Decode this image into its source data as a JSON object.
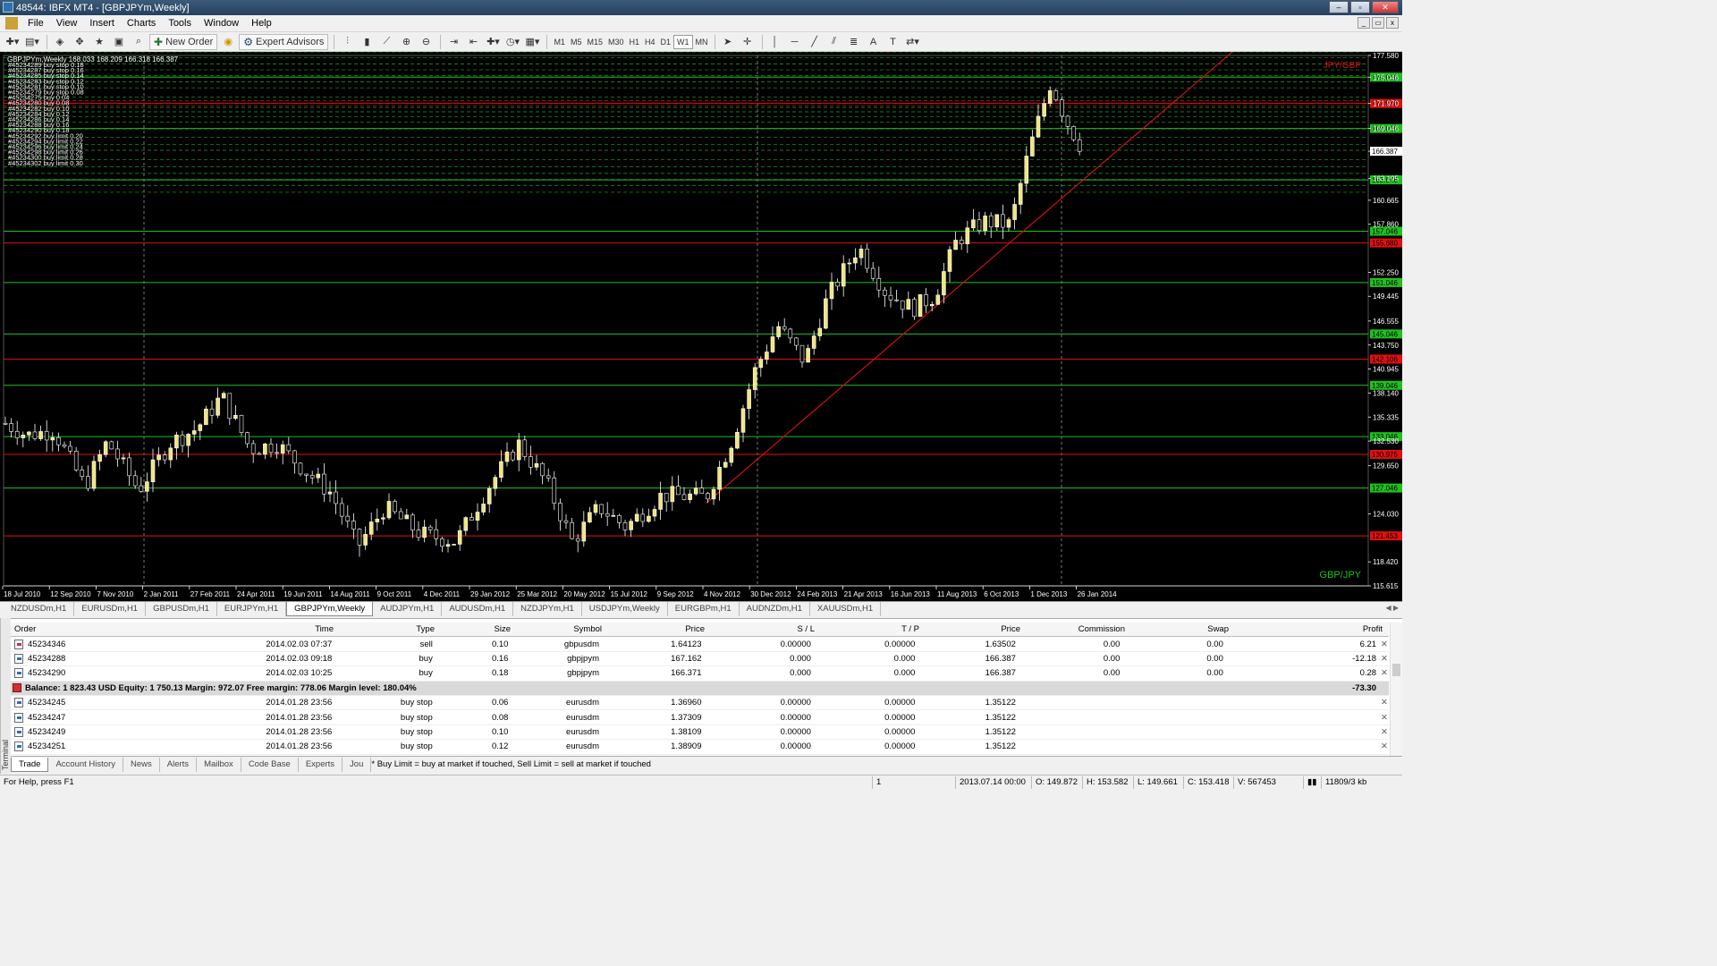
{
  "window": {
    "title": "48544: IBFX MT4 - [GBPJPYm,Weekly]"
  },
  "menu": [
    "File",
    "View",
    "Insert",
    "Charts",
    "Tools",
    "Window",
    "Help"
  ],
  "toolbar": {
    "new_order": "New Order",
    "expert_advisors": "Expert Advisors",
    "timeframes": [
      "M1",
      "M5",
      "M15",
      "M30",
      "H1",
      "H4",
      "D1",
      "W1",
      "MN"
    ],
    "active_timeframe": "W1",
    "text_tool": "A"
  },
  "chart": {
    "header": "GBPJPYm,Weekly  168.033 168.209 166.318 166.387",
    "overlay_label_top": "JPY/GBP",
    "overlay_label_bottom": "GBP/JPY",
    "price_axis": [
      "177.580",
      "175.046",
      "171.970",
      "169.046",
      "166.387",
      "163.195",
      "160.665",
      "157.860",
      "152.250",
      "149.445",
      "146.555",
      "143.750",
      "140.945",
      "138.140",
      "135.335",
      "132.530",
      "129.650",
      "124.030",
      "118.420",
      "115.615"
    ],
    "level_labels": [
      {
        "text": "175.046",
        "color": "green"
      },
      {
        "text": "171.970",
        "color": "red"
      },
      {
        "text": "169.046",
        "color": "green"
      },
      {
        "text": "163.046",
        "color": "green"
      },
      {
        "text": "157.046",
        "color": "green"
      },
      {
        "text": "155.680",
        "color": "red"
      },
      {
        "text": "151.046",
        "color": "green"
      },
      {
        "text": "145.046",
        "color": "green"
      },
      {
        "text": "142.106",
        "color": "red"
      },
      {
        "text": "139.046",
        "color": "green"
      },
      {
        "text": "133.046",
        "color": "green"
      },
      {
        "text": "130.975",
        "color": "red"
      },
      {
        "text": "127.046",
        "color": "green"
      },
      {
        "text": "121.453",
        "color": "red"
      }
    ],
    "date_axis": [
      "18 Jul 2010",
      "12 Sep 2010",
      "7 Nov 2010",
      "2 Jan 2011",
      "27 Feb 2011",
      "24 Apr 2011",
      "19 Jun 2011",
      "14 Aug 2011",
      "9 Oct 2011",
      "4 Dec 2011",
      "29 Jan 2012",
      "25 Mar 2012",
      "20 May 2012",
      "15 Jul 2012",
      "9 Sep 2012",
      "4 Nov 2012",
      "30 Dec 2012",
      "24 Feb 2013",
      "21 Apr 2013",
      "16 Jun 2013",
      "11 Aug 2013",
      "6 Oct 2013",
      "1 Dec 2013",
      "26 Jan 2014"
    ],
    "orders_overlay": [
      "#45234289 buy stop 0.18",
      "#45234287 buy stop 0.16",
      "#45234285 buy stop 0.14",
      "#45234283 buy stop 0.12",
      "#45234281 buy stop 0.10",
      "#45234279 buy stop 0.08",
      "#45234275 buy 0.04",
      "#45234280 buy 0.08",
      "#45234282 buy 0.10",
      "#45234284 buy 0.12",
      "#45234286 buy 0.14",
      "#45234288 buy 0.16",
      "#45234290 buy 0.18",
      "#45234292 buy limit 0.20",
      "#45234294 buy limit 0.22",
      "#45234296 buy limit 0.24",
      "#45234298 buy limit 0.26",
      "#45234300 buy limit 0.28",
      "#45234302 buy limit 0.30"
    ]
  },
  "symbol_tabs": [
    "NZDUSDm,H1",
    "EURUSDm,H1",
    "GBPUSDm,H1",
    "EURJPYm,H1",
    "GBPJPYm,Weekly",
    "AUDJPYm,H1",
    "AUDUSDm,H1",
    "NZDJPYm,H1",
    "USDJPYm,Weekly",
    "EURGBPm,H1",
    "AUDNZDm,H1",
    "XAUUSDm,H1"
  ],
  "active_symbol_tab": "GBPJPYm,Weekly",
  "terminal": {
    "side_label": "Terminal",
    "columns": [
      "Order",
      "Time",
      "Type",
      "Size",
      "Symbol",
      "Price",
      "S / L",
      "T / P",
      "Price",
      "Commission",
      "Swap",
      "Profit"
    ],
    "rows_top": [
      {
        "order": "45234346",
        "time": "2014.02.03 07:37",
        "type": "sell",
        "size": "0.10",
        "symbol": "gbpusdm",
        "price": "1.64123",
        "sl": "0.00000",
        "tp": "0.00000",
        "cur": "1.63502",
        "commission": "0.00",
        "swap": "0.00",
        "profit": "6.21"
      },
      {
        "order": "45234288",
        "time": "2014.02.03 09:18",
        "type": "buy",
        "size": "0.16",
        "symbol": "gbpjpym",
        "price": "167.162",
        "sl": "0.000",
        "tp": "0.000",
        "cur": "166.387",
        "commission": "0.00",
        "swap": "0.00",
        "profit": "-12.18"
      },
      {
        "order": "45234290",
        "time": "2014.02.03 10:25",
        "type": "buy",
        "size": "0.18",
        "symbol": "gbpjpym",
        "price": "166.371",
        "sl": "0.000",
        "tp": "0.000",
        "cur": "166.387",
        "commission": "0.00",
        "swap": "0.00",
        "profit": "0.28"
      }
    ],
    "balance_line": "Balance: 1 823.43 USD  Equity: 1 750.13  Margin: 972.07  Free margin: 778.06  Margin level: 180.04%",
    "balance_total": "-73.30",
    "rows_bottom": [
      {
        "order": "45234245",
        "time": "2014.01.28 23:56",
        "type": "buy stop",
        "size": "0.06",
        "symbol": "eurusdm",
        "price": "1.36960",
        "sl": "0.00000",
        "tp": "0.00000",
        "cur": "1.35122"
      },
      {
        "order": "45234247",
        "time": "2014.01.28 23:56",
        "type": "buy stop",
        "size": "0.08",
        "symbol": "eurusdm",
        "price": "1.37309",
        "sl": "0.00000",
        "tp": "0.00000",
        "cur": "1.35122"
      },
      {
        "order": "45234249",
        "time": "2014.01.28 23:56",
        "type": "buy stop",
        "size": "0.10",
        "symbol": "eurusdm",
        "price": "1.38109",
        "sl": "0.00000",
        "tp": "0.00000",
        "cur": "1.35122"
      },
      {
        "order": "45234251",
        "time": "2014.01.28 23:56",
        "type": "buy stop",
        "size": "0.12",
        "symbol": "eurusdm",
        "price": "1.38909",
        "sl": "0.00000",
        "tp": "0.00000",
        "cur": "1.35122"
      }
    ],
    "tabs": [
      "Trade",
      "Account History",
      "News",
      "Alerts",
      "Mailbox",
      "Code Base",
      "Experts",
      "Jou"
    ],
    "active_tab": "Trade",
    "tab_note": "* Buy Limit = buy at market if touched, Sell Limit = sell at market if touched"
  },
  "status": {
    "help": "For Help, press F1",
    "profile": "1",
    "date": "2013.07.14 00:00",
    "o": "O: 149.872",
    "h": "H: 153.582",
    "l": "L: 149.661",
    "c": "C: 153.418",
    "v": "V: 567453",
    "traffic": "11809/3 kb"
  }
}
